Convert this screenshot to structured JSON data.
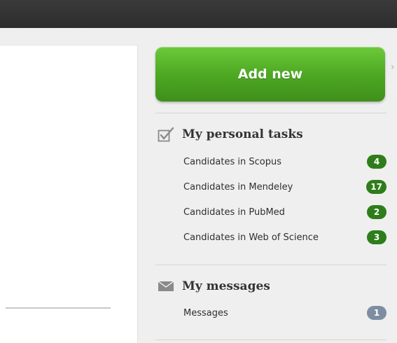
{
  "colors": {
    "topbar": "#2d2d2d",
    "button_green": "#4ea923",
    "badge_green": "#2e7d1b",
    "badge_gray": "#7d8ea3"
  },
  "add_button": {
    "label": "Add new"
  },
  "tasks": {
    "title": "My personal tasks",
    "icon": "checkbox-icon",
    "items": [
      {
        "label": "Candidates in Scopus",
        "count": "4"
      },
      {
        "label": "Candidates in Mendeley",
        "count": "17"
      },
      {
        "label": "Candidates in PubMed",
        "count": "2"
      },
      {
        "label": "Candidates in Web of Science",
        "count": "3"
      }
    ]
  },
  "messages": {
    "title": "My messages",
    "icon": "envelope-icon",
    "items": [
      {
        "label": "Messages",
        "count": "1"
      }
    ]
  }
}
